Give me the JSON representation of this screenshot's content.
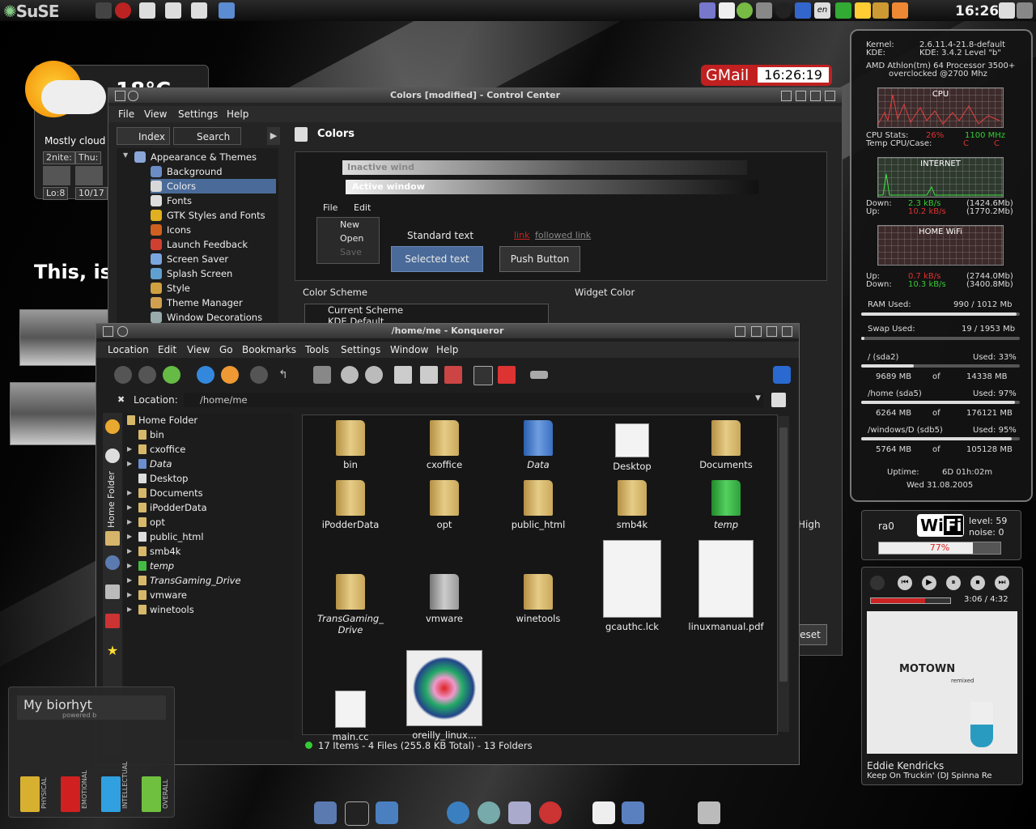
{
  "top_panel": {
    "brand": "SuSE",
    "clock": "16:26",
    "kbd_label": "en"
  },
  "gmail_widget": {
    "label": "GMail",
    "time": "16:26:19"
  },
  "weather": {
    "temp": "18°C",
    "condition": "Mostly cloud",
    "days": [
      "2nite:",
      "Thu:"
    ],
    "low": "Lo:8",
    "date": "10/17"
  },
  "tagline": "This, is",
  "control_center": {
    "title": "Colors [modified] - Control Center",
    "menu": [
      "File",
      "View",
      "Settings",
      "Help"
    ],
    "tabs": {
      "index": "Index",
      "search": "Search"
    },
    "page_title": "Colors",
    "tree": [
      {
        "label": "Appearance & Themes",
        "color": "#8aa6d8"
      },
      {
        "label": "Background",
        "color": "#6b8cc4"
      },
      {
        "label": "Colors",
        "color": "#d8d8d8",
        "selected": true
      },
      {
        "label": "Fonts",
        "color": "#ddd"
      },
      {
        "label": "GTK Styles and Fonts",
        "color": "#e0b020"
      },
      {
        "label": "Icons",
        "color": "#d06020"
      },
      {
        "label": "Launch Feedback",
        "color": "#d04030"
      },
      {
        "label": "Screen Saver",
        "color": "#7aa6e0"
      },
      {
        "label": "Splash Screen",
        "color": "#60a0d0"
      },
      {
        "label": "Style",
        "color": "#d0a040"
      },
      {
        "label": "Theme Manager",
        "color": "#d0a050"
      },
      {
        "label": "Window Decorations",
        "color": "#9aa"
      }
    ],
    "preview": {
      "inactive_title": "Inactive wind",
      "active_title": "Active window",
      "menu": [
        "File",
        "Edit"
      ],
      "file_items": [
        "New",
        "Open",
        "Save"
      ],
      "standard_text": "Standard text",
      "link": "link",
      "followed_link": "followed link",
      "selected_text": "Selected text",
      "push_button": "Push Button"
    },
    "color_scheme_label": "Color Scheme",
    "widget_color_label": "Widget Color",
    "schemes": [
      "Current Scheme",
      "KDE Default"
    ],
    "high_label": "High",
    "reset_label": "eset"
  },
  "konqueror": {
    "title": "/home/me - Konqueror",
    "menu": [
      "Location",
      "Edit",
      "View",
      "Go",
      "Bookmarks",
      "Tools",
      "Settings",
      "Window",
      "Help"
    ],
    "location_label": "Location:",
    "location_value": "/home/me",
    "sidebar_vertical_label": "Home Folder",
    "tree": [
      {
        "label": "Home Folder",
        "expand": ""
      },
      {
        "label": "bin",
        "expand": ""
      },
      {
        "label": "cxoffice",
        "expand": "▶"
      },
      {
        "label": "Data",
        "expand": "▶",
        "italic": true
      },
      {
        "label": "Desktop",
        "expand": ""
      },
      {
        "label": "Documents",
        "expand": "▶"
      },
      {
        "label": "iPodderData",
        "expand": "▶"
      },
      {
        "label": "opt",
        "expand": "▶"
      },
      {
        "label": "public_html",
        "expand": "▶"
      },
      {
        "label": "smb4k",
        "expand": "▶"
      },
      {
        "label": "temp",
        "expand": "▶",
        "italic": true
      },
      {
        "label": "TransGaming_Drive",
        "expand": "▶",
        "italic": true
      },
      {
        "label": "vmware",
        "expand": "▶"
      },
      {
        "label": "winetools",
        "expand": "▶"
      }
    ],
    "files": [
      {
        "label": "bin",
        "kind": "folder"
      },
      {
        "label": "cxoffice",
        "kind": "folder"
      },
      {
        "label": "Data",
        "kind": "folder-blue"
      },
      {
        "label": "Desktop",
        "kind": "desktop"
      },
      {
        "label": "Documents",
        "kind": "folder"
      },
      {
        "label": "iPodderData",
        "kind": "folder"
      },
      {
        "label": "opt",
        "kind": "folder"
      },
      {
        "label": "public_html",
        "kind": "folder"
      },
      {
        "label": "smb4k",
        "kind": "folder"
      },
      {
        "label": "temp",
        "kind": "folder-green"
      },
      {
        "label": "TransGaming_\nDrive",
        "kind": "folder"
      },
      {
        "label": "vmware",
        "kind": "folder-gray"
      },
      {
        "label": "winetools",
        "kind": "folder"
      },
      {
        "label": "gcauthc.lck",
        "kind": "doc"
      },
      {
        "label": "linuxmanual.pdf",
        "kind": "pdf"
      },
      {
        "label": "main.cc",
        "kind": "blank"
      },
      {
        "label": "oreilly_linux...",
        "kind": "poster"
      }
    ],
    "status": "17 Items - 4 Files (255.8 KB Total) - 13 Folders"
  },
  "sysmon": {
    "kernel_label": "Kernel:",
    "kernel": "2.6.11.4-21.8-default",
    "kde_label": "KDE:",
    "kde": "KDE: 3.4.2 Level \"b\"",
    "cpu_line1": "AMD Athlon(tm) 64 Processor 3500+",
    "cpu_line2": "overclocked @2700 Mhz",
    "cpu_graph": "CPU",
    "cpu_stats_label": "CPU Stats:",
    "cpu_pct": "26%",
    "cpu_mhz": "1100 MHz",
    "temp_label": "Temp CPU/Case:",
    "temp_cpu": "C",
    "temp_case": "C",
    "internet_graph": "INTERNET",
    "down_label": "Down:",
    "up_label": "Up:",
    "inet_down": "2.3 kB/s",
    "inet_down_total": "(1424.6Mb)",
    "inet_up": "10.2 kB/s",
    "inet_up_total": "(1770.2Mb)",
    "wifi_graph": "HOME WiFi",
    "wifi_up": "0.7 kB/s",
    "wifi_up_total": "(2744.0Mb)",
    "wifi_down": "10.3 kB/s",
    "wifi_down_total": "(3400.8Mb)",
    "ram_label": "RAM Used:",
    "ram": "990 / 1012 Mb",
    "ram_pct": 0.98,
    "swap_label": "Swap Used:",
    "swap": "19 / 1953 Mb",
    "swap_pct": 0.01,
    "disks": [
      {
        "name": "/ (sda2)",
        "used": "Used: 33%",
        "pct": 0.33,
        "free": "9689 MB",
        "total": "14338 MB"
      },
      {
        "name": "/home (sda5)",
        "used": "Used: 97%",
        "pct": 0.97,
        "free": "6264 MB",
        "total": "176121 MB"
      },
      {
        "name": "/windows/D (sdb5)",
        "used": "Used: 95%",
        "pct": 0.95,
        "free": "5764 MB",
        "total": "105128 MB"
      }
    ],
    "of_label": "of",
    "uptime_label": "Uptime:",
    "uptime": "6D  01h:02m",
    "date": "Wed 31.08.2005"
  },
  "wifi": {
    "iface": "ra0",
    "logo_wi": "Wi",
    "logo_fi": "Fi",
    "level": "level: 59",
    "noise": "noise: 0",
    "quality": "77%",
    "quality_pct": 0.77
  },
  "player": {
    "time": "3:06 / 4:32",
    "album": "MOTOWN",
    "album_sub": "remixed",
    "artist": "Eddie Kendricks",
    "track": "Keep On Truckin' (DJ Spinna Re"
  },
  "biorhythm": {
    "title": "My biorhyt",
    "powered": "powered b",
    "bars": [
      {
        "label": "PHYSICAL",
        "color": "#d8b030"
      },
      {
        "label": "EMOTIONAL",
        "color": "#d02020"
      },
      {
        "label": "INTELLECTUAL",
        "color": "#30a0e0"
      },
      {
        "label": "OVERALL",
        "color": "#70c040"
      }
    ]
  }
}
